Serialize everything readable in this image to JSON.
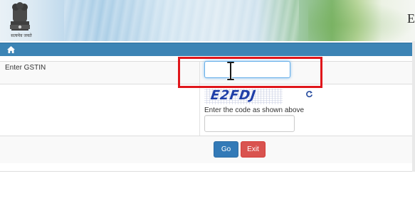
{
  "header": {
    "emblem_caption": "सत्यमेव जयते",
    "partial_title_letter": "E"
  },
  "navbar": {
    "home_icon": "home-icon"
  },
  "form": {
    "gstin_label": "Enter GSTIN",
    "gstin_value": "",
    "captcha_text": "E2FDJ",
    "captcha_instruction": "Enter the code as shown above",
    "captcha_value": "",
    "refresh_icon": "refresh-icon",
    "go_label": "Go",
    "exit_label": "Exit"
  },
  "colors": {
    "navbar": "#3c84b5",
    "go_button": "#337ab7",
    "exit_button": "#d9534f",
    "highlight": "#e0161b"
  }
}
